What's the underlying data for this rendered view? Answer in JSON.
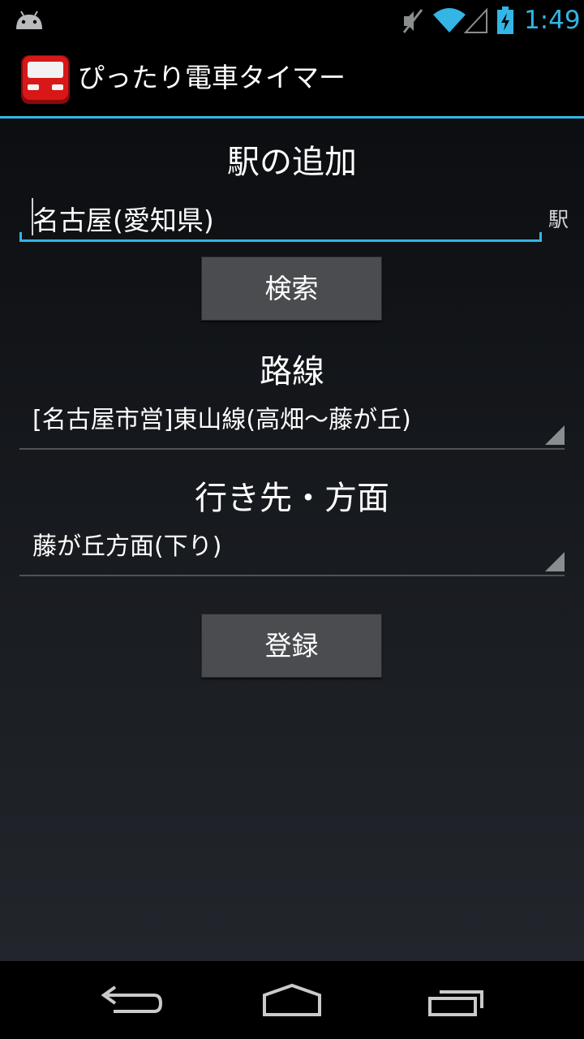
{
  "status_bar": {
    "time": "1:49",
    "icons": [
      "android-icon",
      "mute-icon",
      "wifi-icon",
      "signal-icon",
      "battery-charging-icon"
    ],
    "accent_color": "#33b5e5"
  },
  "action_bar": {
    "title": "ぴったり電車タイマー",
    "app_icon": "train-icon",
    "accent_color": "#cc1111"
  },
  "add_station": {
    "heading": "駅の追加",
    "input_value": "名古屋(愛知県)",
    "suffix": "駅",
    "search_button": "検索"
  },
  "line": {
    "heading": "路線",
    "selected": "[名古屋市営]東山線(高畑〜藤が丘)"
  },
  "direction": {
    "heading": "行き先・方面",
    "selected": "藤が丘方面(下り)"
  },
  "register_button": "登録",
  "nav_bar": {
    "icons": [
      "back-icon",
      "home-icon",
      "recents-icon"
    ]
  }
}
